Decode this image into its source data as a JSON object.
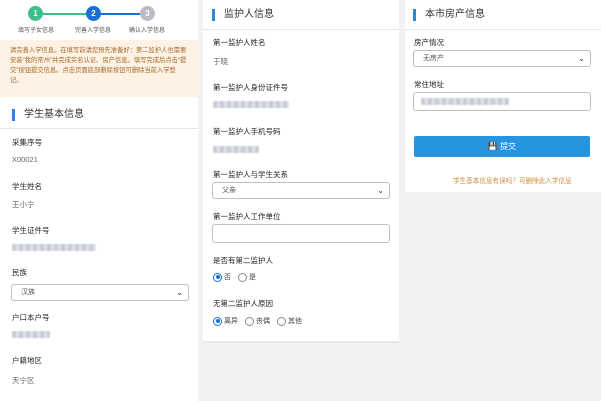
{
  "steps": [
    {
      "number": "1",
      "label": "填写子女信息"
    },
    {
      "number": "2",
      "label": "完善入学信息"
    },
    {
      "number": "3",
      "label": "确认入学信息"
    }
  ],
  "notice": "请完善入学信息。在填写前请您预先准备好：第二监护人也需要安装“我的常州”并完成实名认证、房产信息。填写完成后点击“提交”按钮提交信息。点击页面底部删除按钮可删除当前入学登记。",
  "student": {
    "section_title": "学生基本信息",
    "collect_no_label": "采集序号",
    "collect_no": "X00021",
    "name_label": "学生姓名",
    "name": "王小宁",
    "id_label": "学生证件号",
    "ethnicity_label": "民族",
    "ethnicity": "汉族",
    "hukou_no_label": "户口本户号",
    "hukou_area_label": "户籍地区",
    "hukou_area": "天宁区"
  },
  "guardian": {
    "section_title": "监护人信息",
    "g1_name_label": "第一监护人姓名",
    "g1_name": "于晓",
    "g1_id_label": "第一监护人身份证件号",
    "g1_phone_label": "第一监护人手机号码",
    "g1_relation_label": "第一监护人与学生关系",
    "g1_relation": "父亲",
    "g1_work_label": "第一监护人工作单位",
    "g1_work_value": "",
    "has_g2_label": "是否有第二监护人",
    "has_g2_options": [
      "否",
      "是"
    ],
    "has_g2_selected": "否",
    "no_g2_reason_label": "无第二监护人原因",
    "no_g2_reason_options": [
      "离异",
      "丧偶",
      "其他"
    ],
    "no_g2_reason_selected": "离异"
  },
  "property": {
    "section_title": "本市房产信息",
    "status_label": "房产情况",
    "status": "无房产",
    "address_label": "常住地址"
  },
  "actions": {
    "submit_icon": "save-icon",
    "submit_label": "提交",
    "delete_link": "学生基本信息有误吗？可删除此入学信息"
  },
  "colors": {
    "accent": "#2f86d6",
    "step_done": "#3dbf8a",
    "step_active": "#1a6fd6",
    "step_todo": "#b9bcc4",
    "submit": "#2794e0",
    "link": "#d08a3c",
    "notice_bg": "#fdf2e3"
  }
}
